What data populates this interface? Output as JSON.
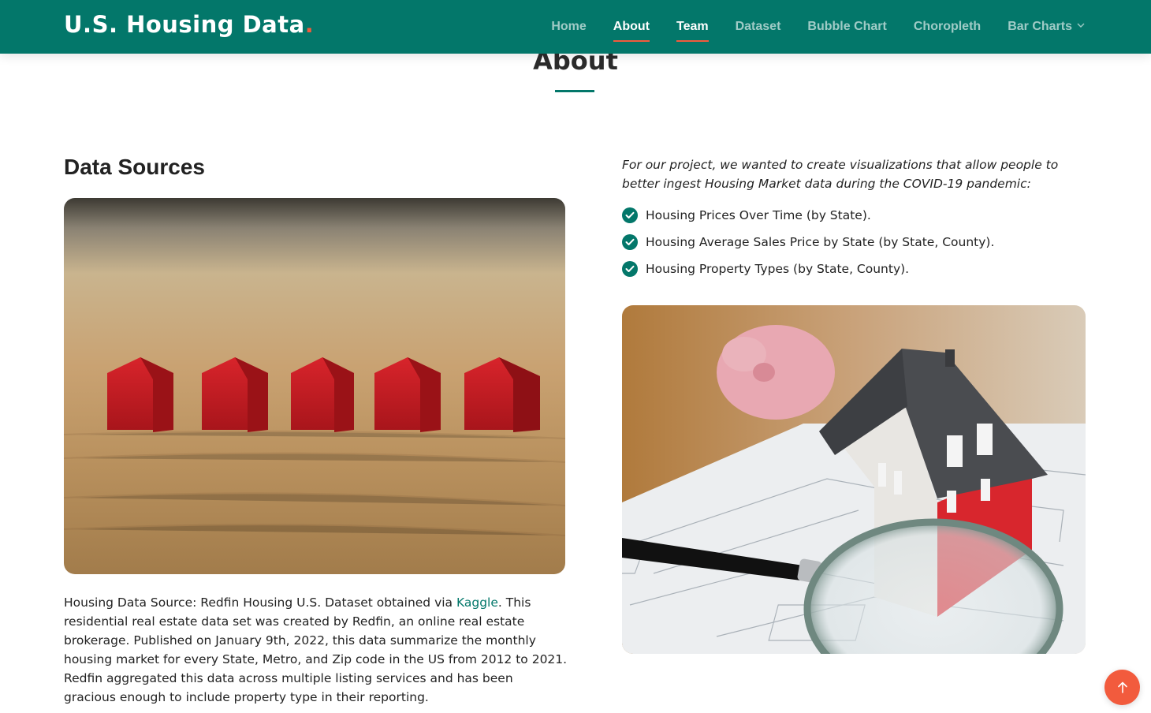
{
  "header": {
    "brand": "U.S. Housing Data",
    "brand_dot": ".",
    "nav": [
      {
        "label": "Home"
      },
      {
        "label": "About"
      },
      {
        "label": "Team"
      },
      {
        "label": "Dataset"
      },
      {
        "label": "Bubble Chart"
      },
      {
        "label": "Choropleth"
      },
      {
        "label": "Bar Charts"
      }
    ]
  },
  "section": {
    "title": "About"
  },
  "left": {
    "heading": "Data Sources",
    "image_icon": "red-houses-photo",
    "source_prefix": "Housing Data Source: Redfin Housing U.S. Dataset obtained via ",
    "source_link": "Kaggle",
    "source_suffix": ". This residential real estate data set was created by Redfin, an online real estate brokerage. Published on January 9th, 2022, this data summarize the monthly housing market for every State, Metro, and Zip code in the US from 2012 to 2021. Redfin aggregated this data across multiple listing services and has been gracious enough to include property type in their reporting."
  },
  "right": {
    "intro": "For our project, we wanted to create visualizations that allow people to better ingest Housing Market data during the COVID-19 pandemic:",
    "checklist": [
      "Housing Prices Over Time (by State).",
      "Housing Average Sales Price by State (by State, County).",
      "Housing Property Types (by State, County)."
    ],
    "image_icon": "house-model-blueprint-photo"
  },
  "colors": {
    "brand": "#03776a",
    "accent": "#f25b3d"
  },
  "back_to_top_icon": "arrow-up-icon"
}
